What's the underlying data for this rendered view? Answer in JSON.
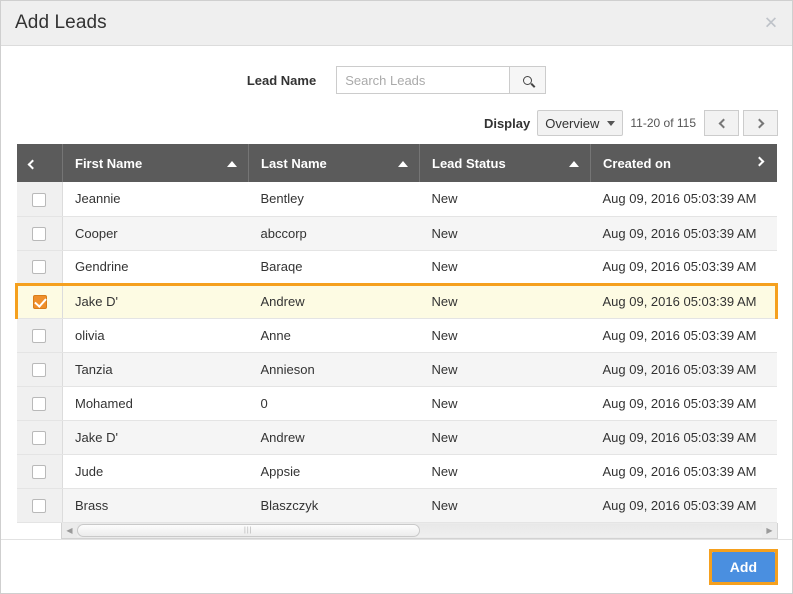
{
  "dialog": {
    "title": "Add Leads",
    "close_icon": "close-icon"
  },
  "search": {
    "label": "Lead Name",
    "placeholder": "Search Leads",
    "value": "",
    "button_icon": "search-icon"
  },
  "pagination": {
    "display_label": "Display",
    "selected_view": "Overview",
    "view_options": [
      "Overview"
    ],
    "range_text": "11-20 of 115",
    "prev_icon": "chevron-left-icon",
    "next_icon": "chevron-right-icon"
  },
  "table": {
    "scroll_left_icon": "chevron-left-icon",
    "scroll_right_icon": "chevron-right-icon",
    "columns": [
      {
        "key": "check",
        "label": ""
      },
      {
        "key": "first",
        "label": "First Name",
        "sorted": true
      },
      {
        "key": "last",
        "label": "Last Name",
        "sorted": true
      },
      {
        "key": "status",
        "label": "Lead Status",
        "sorted": true
      },
      {
        "key": "date",
        "label": "Created on",
        "sorted": false
      }
    ],
    "rows": [
      {
        "checked": false,
        "first": "Jeannie",
        "last": "Bentley",
        "status": "New",
        "date": "Aug 09, 2016 05:03:39 AM"
      },
      {
        "checked": false,
        "first": "Cooper",
        "last": "abccorp",
        "status": "New",
        "date": "Aug 09, 2016 05:03:39 AM"
      },
      {
        "checked": false,
        "first": "Gendrine",
        "last": "Baraqe",
        "status": "New",
        "date": "Aug 09, 2016 05:03:39 AM"
      },
      {
        "checked": true,
        "first": "Jake D'",
        "last": "Andrew",
        "status": "New",
        "date": "Aug 09, 2016 05:03:39 AM"
      },
      {
        "checked": false,
        "first": "olivia",
        "last": "Anne",
        "status": "New",
        "date": "Aug 09, 2016 05:03:39 AM"
      },
      {
        "checked": false,
        "first": "Tanzia",
        "last": "Annieson",
        "status": "New",
        "date": "Aug 09, 2016 05:03:39 AM"
      },
      {
        "checked": false,
        "first": "Mohamed",
        "last": "0",
        "status": "New",
        "date": "Aug 09, 2016 05:03:39 AM"
      },
      {
        "checked": false,
        "first": "Jake D'",
        "last": "Andrew",
        "status": "New",
        "date": "Aug 09, 2016 05:03:39 AM"
      },
      {
        "checked": false,
        "first": "Jude",
        "last": "Appsie",
        "status": "New",
        "date": "Aug 09, 2016 05:03:39 AM"
      },
      {
        "checked": false,
        "first": "Brass",
        "last": "Blaszczyk",
        "status": "New",
        "date": "Aug 09, 2016 05:03:39 AM"
      }
    ],
    "selected_row_index": 3
  },
  "scrollbar": {
    "thumb_percent": 50,
    "left_arrow_icon": "triangle-left-icon",
    "right_arrow_icon": "triangle-right-icon",
    "grip_icon": "grip-icon"
  },
  "footer": {
    "add_label": "Add"
  },
  "colors": {
    "accent_orange": "#f5a01e",
    "button_blue": "#4a8fe0",
    "header_gray": "#5b5b5b",
    "selected_row_bg": "#fdfbe3",
    "stripe_bg": "#f5f5f5",
    "titlebar_bg": "#efefef"
  }
}
